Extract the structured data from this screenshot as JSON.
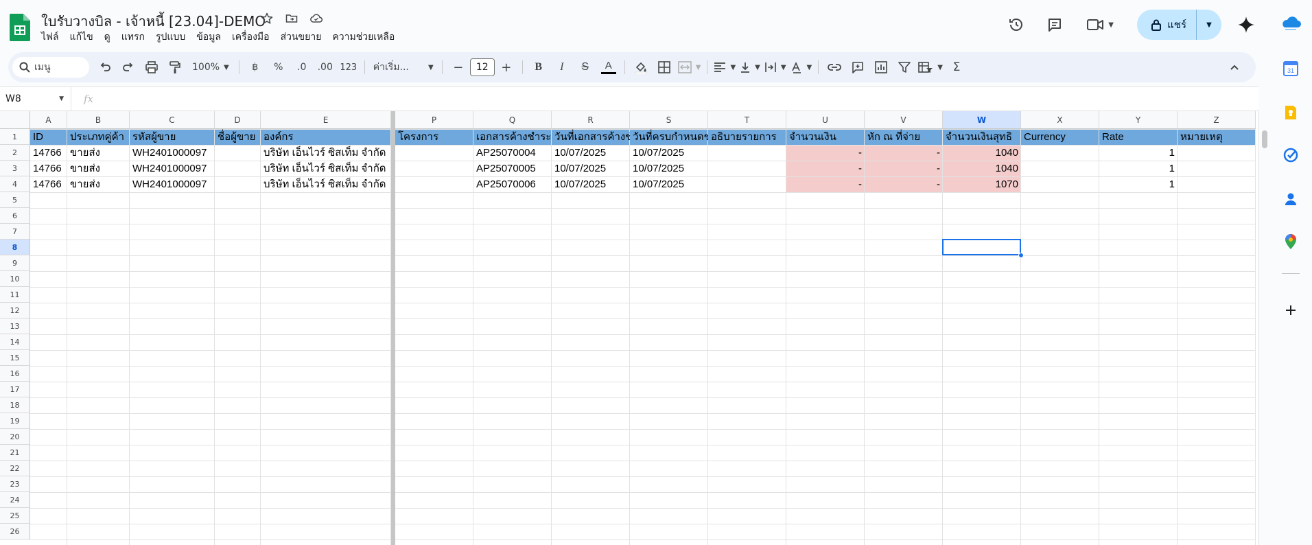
{
  "doc": {
    "title": "ใบรับวางบิล - เจ้าหนี้ [23.04]-DEMO"
  },
  "menu": [
    "ไฟล์",
    "แก้ไข",
    "ดู",
    "แทรก",
    "รูปแบบ",
    "ข้อมูล",
    "เครื่องมือ",
    "ส่วนขยาย",
    "ความช่วยเหลือ"
  ],
  "share": {
    "label": "แชร์"
  },
  "toolbar": {
    "search_label": "เมนู",
    "zoom": "100%",
    "currency": "฿",
    "percent": "%",
    "dec_decrease": ".0",
    "dec_increase": ".00",
    "number_format": "123",
    "font_name": "ค่าเริ่ม...",
    "font_size": "12",
    "minus": "−",
    "plus": "+",
    "sigma": "Σ"
  },
  "formula": {
    "name_box": "W8",
    "fx": "fx",
    "value": ""
  },
  "grid": {
    "columns": [
      {
        "letter": "A",
        "w": 54
      },
      {
        "letter": "B",
        "w": 91
      },
      {
        "letter": "C",
        "w": 124
      },
      {
        "letter": "D",
        "w": 67
      },
      {
        "letter": "E",
        "w": 190
      },
      {
        "letter": "P",
        "w": 114
      },
      {
        "letter": "Q",
        "w": 114
      },
      {
        "letter": "R",
        "w": 114
      },
      {
        "letter": "S",
        "w": 114
      },
      {
        "letter": "T",
        "w": 114
      },
      {
        "letter": "U",
        "w": 114
      },
      {
        "letter": "V",
        "w": 114
      },
      {
        "letter": "W",
        "w": 114
      },
      {
        "letter": "X",
        "w": 114
      },
      {
        "letter": "Y",
        "w": 114
      },
      {
        "letter": "Z",
        "w": 114
      }
    ],
    "selected_col": "W",
    "selected_row": 8,
    "row_count": 26,
    "header_row": [
      "ID",
      "ประเภทคู่ค้า",
      "รหัสผู้ขาย",
      "ชื่อผู้ขาย",
      "องค์กร",
      "โครงการ",
      "เอกสารค้างชำระ",
      "วันที่เอกสารค้างชำ",
      "วันที่ครบกำหนดชำ",
      "อธิบายรายการ",
      "จำนวนเงิน",
      "หัก ณ ที่จ่าย",
      "จำนวนเงินสุทธิ",
      "Currency",
      "Rate",
      "หมายเหตุ"
    ],
    "rows": [
      [
        "14766",
        "ขายส่ง",
        "WH2401000097",
        "",
        "บริษัท เอ็นไวร์ ซิสเท็ม จำกัด",
        "",
        "AP25070004",
        "10/07/2025",
        "10/07/2025",
        "",
        "-",
        "-",
        "1040",
        "",
        "1",
        ""
      ],
      [
        "14766",
        "ขายส่ง",
        "WH2401000097",
        "",
        "บริษัท เอ็นไวร์ ซิสเท็ม จำกัด",
        "",
        "AP25070005",
        "10/07/2025",
        "10/07/2025",
        "",
        "-",
        "-",
        "1040",
        "",
        "1",
        ""
      ],
      [
        "14766",
        "ขายส่ง",
        "WH2401000097",
        "",
        "บริษัท เอ็นไวร์ ซิสเท็ม จำกัด",
        "",
        "AP25070006",
        "10/07/2025",
        "10/07/2025",
        "",
        "-",
        "-",
        "1070",
        "",
        "1",
        ""
      ]
    ],
    "numeric_cols": [
      "U",
      "V",
      "W",
      "Y"
    ],
    "pink_cols": [
      "U",
      "V",
      "W"
    ],
    "colors": {
      "header_fill": "#6fa8dc",
      "pink_fill": "#f4cccc",
      "selection": "#1a73e8"
    }
  }
}
